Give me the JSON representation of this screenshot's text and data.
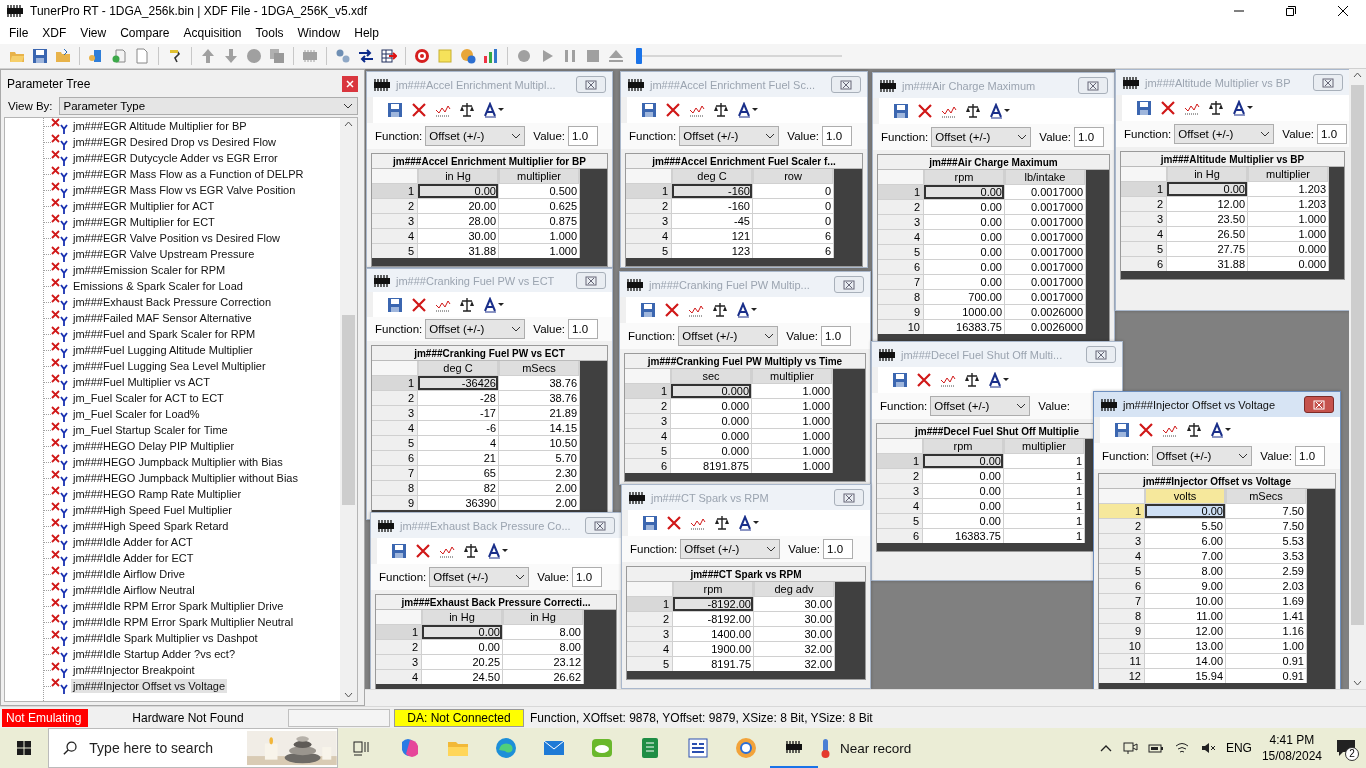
{
  "window": {
    "title": "TunerPro RT - 1DGA_256k.bin | XDF File - 1DGA_256K_v5.xdf"
  },
  "menu": [
    "File",
    "XDF",
    "View",
    "Compare",
    "Acquisition",
    "Tools",
    "Window",
    "Help"
  ],
  "toolbar": {
    "slider": {
      "level": 0
    }
  },
  "parameter_tree": {
    "title": "Parameter Tree",
    "view_by": {
      "label": "View By:",
      "value": "Parameter Type"
    },
    "items": [
      {
        "label": "jm###EGR Altitude Multiplier for BP",
        "selected": false
      },
      {
        "label": "jm###EGR Desired Drop vs Desired Flow",
        "selected": false
      },
      {
        "label": "jm###EGR Dutycycle Adder vs EGR Error",
        "selected": false
      },
      {
        "label": "jm###EGR Mass Flow as a Function of DELPR",
        "selected": false
      },
      {
        "label": "jm###EGR Mass Flow vs EGR Valve Position",
        "selected": false
      },
      {
        "label": "jm###EGR Multiplier for ACT",
        "selected": false
      },
      {
        "label": "jm###EGR Multiplier for ECT",
        "selected": false
      },
      {
        "label": "jm###EGR Valve Position vs Desired Flow",
        "selected": false
      },
      {
        "label": "jm###EGR Valve Upstream Pressure",
        "selected": false
      },
      {
        "label": "jm###Emission Scaler for RPM",
        "selected": false
      },
      {
        "label": "Emissions & Spark Scaler for Load",
        "selected": false
      },
      {
        "label": "jm###Exhaust Back Pressure Correction",
        "selected": false
      },
      {
        "label": "jm###Failed MAF Sensor Alternative",
        "selected": false
      },
      {
        "label": "jm###Fuel and Spark Scaler for RPM",
        "selected": false
      },
      {
        "label": "jm###Fuel Lugging Altitude Multiplier",
        "selected": false
      },
      {
        "label": "jm###Fuel Lugging Sea Level Multiplier",
        "selected": false
      },
      {
        "label": "jm###Fuel Multiplier vs ACT",
        "selected": false
      },
      {
        "label": "jm_Fuel Scaler for ACT to ECT",
        "selected": false
      },
      {
        "label": "jm_Fuel Scaler for Load%",
        "selected": false
      },
      {
        "label": "jm_Fuel Startup Scaler for Time",
        "selected": false
      },
      {
        "label": "jm###HEGO Delay PIP Multiplier",
        "selected": false
      },
      {
        "label": "jm###HEGO Jumpback Multiplier with Bias",
        "selected": false
      },
      {
        "label": "jm###HEGO Jumpback Multiplier without Bias",
        "selected": false
      },
      {
        "label": "jm###HEGO Ramp Rate Multiplier",
        "selected": false
      },
      {
        "label": "jm###High Speed Fuel Multiplier",
        "selected": false
      },
      {
        "label": "jm###High Speed Spark Retard",
        "selected": false
      },
      {
        "label": "jm###Idle Adder for ACT",
        "selected": false
      },
      {
        "label": "jm###Idle Adder for ECT",
        "selected": false
      },
      {
        "label": "jm###Idle Airflow Drive",
        "selected": false
      },
      {
        "label": "jm###Idle Airflow Neutral",
        "selected": false
      },
      {
        "label": "jm###Idle RPM Error Spark Multiplier Drive",
        "selected": false
      },
      {
        "label": "jm###Idle RPM Error Spark Multiplier Neutral",
        "selected": false
      },
      {
        "label": "jm###Idle Spark Multiplier vs Dashpot",
        "selected": false
      },
      {
        "label": "jm###Idle Startup Adder ?vs ect?",
        "selected": false
      },
      {
        "label": "jm###Injector Breakpoint",
        "selected": false
      },
      {
        "label": "jm###Injector Offset vs Voltage",
        "selected": true
      }
    ]
  },
  "tables": [
    {
      "title": "jm###Accel Enrichment Multipl...",
      "active": false,
      "function": {
        "label": "Function:",
        "value": "Offset (+/-)"
      },
      "value": {
        "label": "Value:",
        "value": "1.0"
      },
      "table_title": "jm###Accel Enrichment Multiplier for BP",
      "columns": [
        "in Hg",
        "multiplier"
      ],
      "rows": [
        {
          "label": "1",
          "cells": [
            "0.00",
            "0.500"
          ],
          "selected": true
        },
        {
          "label": "2",
          "cells": [
            "20.00",
            "0.625"
          ],
          "selected": false
        },
        {
          "label": "3",
          "cells": [
            "28.00",
            "0.875"
          ],
          "selected": false
        },
        {
          "label": "4",
          "cells": [
            "30.00",
            "1.000"
          ],
          "selected": false
        },
        {
          "label": "5",
          "cells": [
            "31.88",
            "1.000"
          ],
          "selected": false
        }
      ]
    },
    {
      "title": "jm###Accel Enrichment Fuel Sc...",
      "active": false,
      "function": {
        "label": "Function:",
        "value": "Offset (+/-)"
      },
      "value": {
        "label": "Value:",
        "value": "1.0"
      },
      "table_title": "jm###Accel Enrichment Fuel Scaler f...",
      "columns": [
        "deg C",
        "row"
      ],
      "rows": [
        {
          "label": "1",
          "cells": [
            "-160",
            "0"
          ],
          "selected": true
        },
        {
          "label": "2",
          "cells": [
            "-160",
            "0"
          ],
          "selected": false
        },
        {
          "label": "3",
          "cells": [
            "-45",
            "0"
          ],
          "selected": false
        },
        {
          "label": "4",
          "cells": [
            "121",
            "6"
          ],
          "selected": false
        },
        {
          "label": "5",
          "cells": [
            "123",
            "6"
          ],
          "selected": false
        }
      ]
    },
    {
      "title": "jm###Air Charge Maximum",
      "active": false,
      "function": {
        "label": "Function:",
        "value": "Offset (+/-)"
      },
      "value": {
        "label": "Value:",
        "value": "1.0"
      },
      "table_title": "jm###Air Charge Maximum",
      "columns": [
        "rpm",
        "lb/intake"
      ],
      "rows": [
        {
          "label": "1",
          "cells": [
            "0.00",
            "0.0017000"
          ],
          "selected": true
        },
        {
          "label": "2",
          "cells": [
            "0.00",
            "0.0017000"
          ],
          "selected": false
        },
        {
          "label": "3",
          "cells": [
            "0.00",
            "0.0017000"
          ],
          "selected": false
        },
        {
          "label": "4",
          "cells": [
            "0.00",
            "0.0017000"
          ],
          "selected": false
        },
        {
          "label": "5",
          "cells": [
            "0.00",
            "0.0017000"
          ],
          "selected": false
        },
        {
          "label": "6",
          "cells": [
            "0.00",
            "0.0017000"
          ],
          "selected": false
        },
        {
          "label": "7",
          "cells": [
            "0.00",
            "0.0017000"
          ],
          "selected": false
        },
        {
          "label": "8",
          "cells": [
            "700.00",
            "0.0017000"
          ],
          "selected": false
        },
        {
          "label": "9",
          "cells": [
            "1000.00",
            "0.0026000"
          ],
          "selected": false
        },
        {
          "label": "10",
          "cells": [
            "16383.75",
            "0.0026000"
          ],
          "selected": false
        }
      ]
    },
    {
      "title": "jm###Altitude Multiplier vs BP",
      "active": false,
      "function": {
        "label": "Function:",
        "value": "Offset (+/-)"
      },
      "value": {
        "label": "Value:",
        "value": "1.0"
      },
      "table_title": "jm###Altitude Multiplier vs BP",
      "columns": [
        "in Hg",
        "multiplier"
      ],
      "rows": [
        {
          "label": "1",
          "cells": [
            "0.00",
            "1.203"
          ],
          "selected": true
        },
        {
          "label": "2",
          "cells": [
            "12.00",
            "1.203"
          ],
          "selected": false
        },
        {
          "label": "3",
          "cells": [
            "23.50",
            "1.000"
          ],
          "selected": false
        },
        {
          "label": "4",
          "cells": [
            "26.50",
            "1.000"
          ],
          "selected": false
        },
        {
          "label": "5",
          "cells": [
            "27.75",
            "0.000"
          ],
          "selected": false
        },
        {
          "label": "6",
          "cells": [
            "31.88",
            "0.000"
          ],
          "selected": false
        }
      ]
    },
    {
      "title": "jm###Cranking Fuel PW vs ECT",
      "active": false,
      "function": {
        "label": "Function:",
        "value": "Offset (+/-)"
      },
      "value": {
        "label": "Value:",
        "value": "1.0"
      },
      "table_title": "jm###Cranking Fuel PW vs ECT",
      "columns": [
        "deg C",
        "mSecs"
      ],
      "rows": [
        {
          "label": "1",
          "cells": [
            "-36426",
            "38.76"
          ],
          "selected": true
        },
        {
          "label": "2",
          "cells": [
            "-28",
            "38.76"
          ],
          "selected": false
        },
        {
          "label": "3",
          "cells": [
            "-17",
            "21.89"
          ],
          "selected": false
        },
        {
          "label": "4",
          "cells": [
            "-6",
            "14.15"
          ],
          "selected": false
        },
        {
          "label": "5",
          "cells": [
            "4",
            "10.50"
          ],
          "selected": false
        },
        {
          "label": "6",
          "cells": [
            "21",
            "5.70"
          ],
          "selected": false
        },
        {
          "label": "7",
          "cells": [
            "65",
            "2.30"
          ],
          "selected": false
        },
        {
          "label": "8",
          "cells": [
            "82",
            "2.00"
          ],
          "selected": false
        },
        {
          "label": "9",
          "cells": [
            "36390",
            "2.00"
          ],
          "selected": false
        }
      ]
    },
    {
      "title": "jm###Cranking Fuel PW Multip...",
      "active": false,
      "function": {
        "label": "Function:",
        "value": "Offset (+/-)"
      },
      "value": {
        "label": "Value:",
        "value": "1.0"
      },
      "table_title": "jm###Cranking Fuel PW Multiply vs Time",
      "columns": [
        "sec",
        "multiplier"
      ],
      "rows": [
        {
          "label": "1",
          "cells": [
            "0.000",
            "1.000"
          ],
          "selected": true
        },
        {
          "label": "2",
          "cells": [
            "0.000",
            "1.000"
          ],
          "selected": false
        },
        {
          "label": "3",
          "cells": [
            "0.000",
            "1.000"
          ],
          "selected": false
        },
        {
          "label": "4",
          "cells": [
            "0.000",
            "1.000"
          ],
          "selected": false
        },
        {
          "label": "5",
          "cells": [
            "0.000",
            "1.000"
          ],
          "selected": false
        },
        {
          "label": "6",
          "cells": [
            "8191.875",
            "1.000"
          ],
          "selected": false
        }
      ]
    },
    {
      "title": "jm###Decel Fuel Shut Off Multi...",
      "active": false,
      "function": {
        "label": "Function:",
        "value": "Offset (+/-)"
      },
      "value": {
        "label": "Value:"
      },
      "table_title": "jm###Decel Fuel Shut Off Multiplie",
      "columns": [
        "rpm",
        "multiplier"
      ],
      "rows": [
        {
          "label": "1",
          "cells": [
            "0.00",
            "1"
          ],
          "selected": true
        },
        {
          "label": "2",
          "cells": [
            "0.00",
            "1"
          ],
          "selected": false
        },
        {
          "label": "3",
          "cells": [
            "0.00",
            "1"
          ],
          "selected": false
        },
        {
          "label": "4",
          "cells": [
            "0.00",
            "1"
          ],
          "selected": false
        },
        {
          "label": "5",
          "cells": [
            "0.00",
            "1"
          ],
          "selected": false
        },
        {
          "label": "6",
          "cells": [
            "16383.75",
            "1"
          ],
          "selected": false
        }
      ]
    },
    {
      "title": "jm###Exhaust Back Pressure Co...",
      "active": false,
      "function": {
        "label": "Function:",
        "value": "Offset (+/-)"
      },
      "value": {
        "label": "Value:",
        "value": "1.0"
      },
      "table_title": "jm###Exhaust Back Pressure Correcti...",
      "columns": [
        "in Hg",
        "in Hg"
      ],
      "rows": [
        {
          "label": "1",
          "cells": [
            "0.00",
            "8.00"
          ],
          "selected": true
        },
        {
          "label": "2",
          "cells": [
            "0.00",
            "8.00"
          ],
          "selected": false
        },
        {
          "label": "3",
          "cells": [
            "20.25",
            "23.12"
          ],
          "selected": false
        },
        {
          "label": "4",
          "cells": [
            "24.50",
            "26.62"
          ],
          "selected": false
        }
      ]
    },
    {
      "title": "jm###CT Spark vs RPM",
      "active": false,
      "function": {
        "label": "Function:",
        "value": "Offset (+/-)"
      },
      "value": {
        "label": "Value:",
        "value": "1.0"
      },
      "table_title": "jm###CT Spark vs RPM",
      "columns": [
        "rpm",
        "deg adv"
      ],
      "rows": [
        {
          "label": "1",
          "cells": [
            "-8192.00",
            "30.00"
          ],
          "selected": true
        },
        {
          "label": "2",
          "cells": [
            "-8192.00",
            "30.00"
          ],
          "selected": false
        },
        {
          "label": "3",
          "cells": [
            "1400.00",
            "30.00"
          ],
          "selected": false
        },
        {
          "label": "4",
          "cells": [
            "1900.00",
            "32.00"
          ],
          "selected": false
        },
        {
          "label": "5",
          "cells": [
            "8191.75",
            "32.00"
          ],
          "selected": false
        }
      ]
    },
    {
      "title": "jm###Injector Offset vs Voltage",
      "active": true,
      "function": {
        "label": "Function:",
        "value": "Offset (+/-)"
      },
      "value": {
        "label": "Value:",
        "value": "1.0"
      },
      "table_title": "jm###Injector Offset vs Voltage",
      "columns": [
        "volts",
        "mSecs"
      ],
      "rows": [
        {
          "label": "1",
          "cells": [
            "0.00",
            "7.50"
          ],
          "selected": true
        },
        {
          "label": "2",
          "cells": [
            "5.50",
            "7.50"
          ],
          "selected": false
        },
        {
          "label": "3",
          "cells": [
            "6.00",
            "5.53"
          ],
          "selected": false
        },
        {
          "label": "4",
          "cells": [
            "7.00",
            "3.53"
          ],
          "selected": false
        },
        {
          "label": "5",
          "cells": [
            "8.00",
            "2.59"
          ],
          "selected": false
        },
        {
          "label": "6",
          "cells": [
            "9.00",
            "2.03"
          ],
          "selected": false
        },
        {
          "label": "7",
          "cells": [
            "10.00",
            "1.69"
          ],
          "selected": false
        },
        {
          "label": "8",
          "cells": [
            "11.00",
            "1.41"
          ],
          "selected": false
        },
        {
          "label": "9",
          "cells": [
            "12.00",
            "1.16"
          ],
          "selected": false
        },
        {
          "label": "10",
          "cells": [
            "13.00",
            "1.00"
          ],
          "selected": false
        },
        {
          "label": "11",
          "cells": [
            "14.00",
            "0.91"
          ],
          "selected": false
        },
        {
          "label": "12",
          "cells": [
            "15.94",
            "0.91"
          ],
          "selected": false
        }
      ]
    }
  ],
  "status_bar": {
    "emulation": "Not Emulating",
    "hardware": "Hardware Not Found",
    "da": "DA: Not Connected",
    "info": "Function, XOffset: 9878, YOffset: 9879, XSize: 8 Bit, YSize: 8 Bit"
  },
  "taskbar": {
    "search": {
      "placeholder": "Type here to search"
    },
    "weather": "Near record",
    "language": "ENG",
    "time": "4:41 PM",
    "date": "15/08/2024",
    "notifications": "2"
  }
}
